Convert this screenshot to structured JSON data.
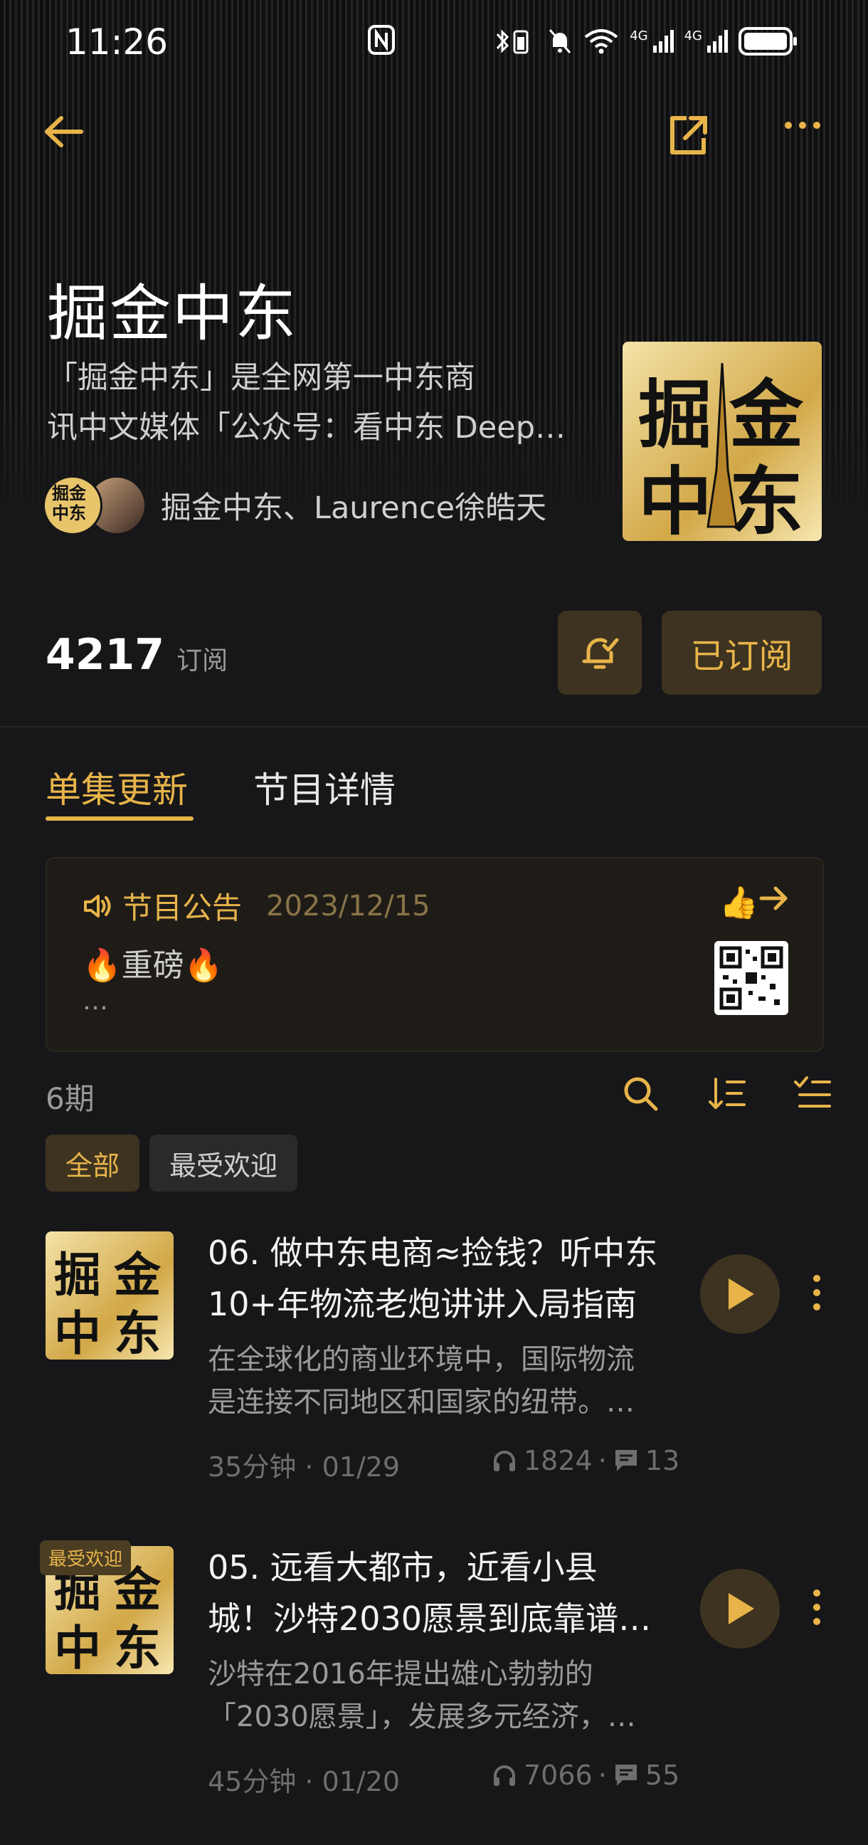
{
  "status_bar": {
    "time": "11:26",
    "net_label_1": "4G",
    "net_label_2": "4G"
  },
  "podcast": {
    "title": "掘金中东",
    "description_line1": "「掘金中东」是全网第一中东商",
    "description_line2": "讯中文媒体「公众号：看中东 Deep…",
    "hosts": "掘金中东、Laurence徐皓天",
    "cover_text": [
      "掘",
      "金",
      "中",
      "东"
    ],
    "subscriber_count": "4217",
    "subscriber_unit": "订阅",
    "subscribe_label": "已订阅"
  },
  "tabs": [
    {
      "label": "单集更新",
      "active": true
    },
    {
      "label": "节目详情",
      "active": false
    }
  ],
  "announcement": {
    "label": "节目公告",
    "date": "2023/12/15",
    "body": "🔥重磅🔥",
    "more": "…",
    "thumb": "👍"
  },
  "episode_list": {
    "count": "6期",
    "filters": [
      {
        "label": "全部",
        "active": true
      },
      {
        "label": "最受欢迎",
        "active": false
      }
    ]
  },
  "episodes": [
    {
      "title_line1": "06. 做中东电商≈捡钱？听中东",
      "title_line2": "10+年物流老炮讲讲入局指南",
      "desc_line1": "在全球化的商业环境中，国际物流",
      "desc_line2": "是连接不同地区和国家的纽带。…",
      "duration_date": "35分钟 · 01/29",
      "plays": "1824",
      "comments": "13",
      "badge": ""
    },
    {
      "title_line1": "05. 远看大都市，近看小县",
      "title_line2": "城！沙特2030愿景到底靠谱…",
      "desc_line1": "沙特在2016年提出雄心勃勃的",
      "desc_line2": "「2030愿景」，发展多元经济，…",
      "duration_date": "45分钟 · 01/20",
      "plays": "7066",
      "comments": "55",
      "badge": "最受欢迎"
    }
  ],
  "colors": {
    "accent": "#e8b44a",
    "accent_bg": "#3d3320",
    "background": "#171719"
  }
}
